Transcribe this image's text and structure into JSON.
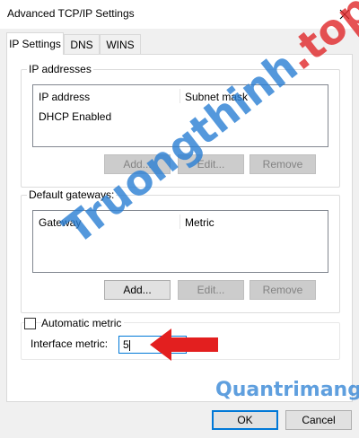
{
  "window": {
    "title": "Advanced TCP/IP Settings",
    "close_glyph": "✕"
  },
  "tabs": [
    {
      "label": "IP Settings",
      "active": true
    },
    {
      "label": "DNS",
      "active": false
    },
    {
      "label": "WINS",
      "active": false
    }
  ],
  "ip_addresses": {
    "group_label": "IP addresses",
    "columns": [
      "IP address",
      "Subnet mask"
    ],
    "rows": [
      [
        "DHCP Enabled",
        ""
      ]
    ],
    "buttons": {
      "add": "Add...",
      "edit": "Edit...",
      "remove": "Remove"
    }
  },
  "default_gateways": {
    "group_label": "Default gateways:",
    "columns": [
      "Gateway",
      "Metric"
    ],
    "rows": [],
    "buttons": {
      "add": "Add...",
      "edit": "Edit...",
      "remove": "Remove"
    }
  },
  "metric": {
    "automatic_label": "Automatic metric",
    "automatic_checked": false,
    "interface_label": "Interface metric:",
    "interface_value": "5"
  },
  "footer": {
    "ok_label": "OK",
    "cancel_label": "Cancel"
  },
  "watermark": {
    "text_main": "Truongthinh",
    "text_top": ".top",
    "text_sub": "Quantrimang"
  },
  "colors": {
    "accent": "#0078d7",
    "arrow": "#e31f1f",
    "watermark_blue": "#2a7fd4",
    "watermark_red": "#e0282a"
  }
}
